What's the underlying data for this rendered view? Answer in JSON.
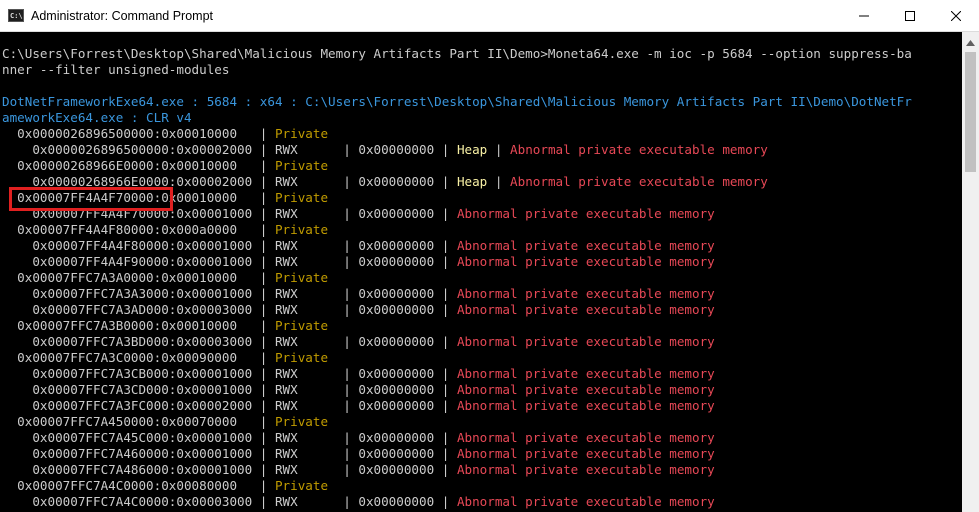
{
  "window": {
    "title": "Administrator: Command Prompt",
    "icon": "cmd-icon",
    "icon_text": "C:\\.",
    "controls": [
      "minimize-icon",
      "maximize-icon",
      "close-icon"
    ]
  },
  "console_lines": [
    {
      "segments": [
        {
          "text": "C:\\Users\\Forrest\\Desktop\\Shared\\Malicious Memory Artifacts Part II\\Demo>Moneta64.exe -m ioc -p 5684 --option suppress-ba",
          "color": "w"
        }
      ]
    },
    {
      "segments": [
        {
          "text": "nner --filter unsigned-modules",
          "color": "w"
        }
      ]
    },
    {
      "segments": [
        {
          "text": "",
          "color": "w"
        }
      ]
    },
    {
      "segments": [
        {
          "text": "DotNetFrameworkExe64.exe : 5684 : x64 : C:\\Users\\Forrest\\Desktop\\Shared\\Malicious Memory Artifacts Part II\\Demo\\DotNetFr",
          "color": "cy"
        }
      ]
    },
    {
      "segments": [
        {
          "text": "ameworkExe64.exe : CLR v4",
          "color": "cy"
        }
      ]
    },
    {
      "segments": [
        {
          "text": "  0x0000026896500000:0x00010000   | ",
          "color": "w"
        },
        {
          "text": "Private",
          "color": "y"
        }
      ]
    },
    {
      "segments": [
        {
          "text": "    0x0000026896500000:0x00002000 | RWX      | 0x00000000 | ",
          "color": "w"
        },
        {
          "text": "Heap",
          "color": "hy"
        },
        {
          "text": " | ",
          "color": "w"
        },
        {
          "text": "Abnormal private executable memory",
          "color": "r"
        }
      ]
    },
    {
      "segments": [
        {
          "text": "  0x00000268966E0000:0x00010000   | ",
          "color": "w"
        },
        {
          "text": "Private",
          "color": "y"
        }
      ]
    },
    {
      "segments": [
        {
          "text": "    0x00000268966E0000:0x00002000 | RWX      | 0x00000000 | ",
          "color": "w"
        },
        {
          "text": "Heap",
          "color": "hy"
        },
        {
          "text": " | ",
          "color": "w"
        },
        {
          "text": "Abnormal private executable memory",
          "color": "r"
        }
      ]
    },
    {
      "segments": [
        {
          "text": "  0x00007FF4A4F70000:0x00010000   | ",
          "color": "w"
        },
        {
          "text": "Private",
          "color": "y"
        }
      ]
    },
    {
      "segments": [
        {
          "text": "    0x00007FF4A4F70000:0x00001000 | RWX      | 0x00000000 | ",
          "color": "w"
        },
        {
          "text": "Abnormal private executable memory",
          "color": "r"
        }
      ]
    },
    {
      "segments": [
        {
          "text": "  0x00007FF4A4F80000:0x000a0000   | ",
          "color": "w"
        },
        {
          "text": "Private",
          "color": "y"
        }
      ]
    },
    {
      "segments": [
        {
          "text": "    0x00007FF4A4F80000:0x00001000 | RWX      | 0x00000000 | ",
          "color": "w"
        },
        {
          "text": "Abnormal private executable memory",
          "color": "r"
        }
      ]
    },
    {
      "segments": [
        {
          "text": "    0x00007FF4A4F90000:0x00001000 | RWX      | 0x00000000 | ",
          "color": "w"
        },
        {
          "text": "Abnormal private executable memory",
          "color": "r"
        }
      ]
    },
    {
      "segments": [
        {
          "text": "  0x00007FFC7A3A0000:0x00010000   | ",
          "color": "w"
        },
        {
          "text": "Private",
          "color": "y"
        }
      ]
    },
    {
      "segments": [
        {
          "text": "    0x00007FFC7A3A3000:0x00001000 | RWX      | 0x00000000 | ",
          "color": "w"
        },
        {
          "text": "Abnormal private executable memory",
          "color": "r"
        }
      ]
    },
    {
      "segments": [
        {
          "text": "    0x00007FFC7A3AD000:0x00003000 | RWX      | 0x00000000 | ",
          "color": "w"
        },
        {
          "text": "Abnormal private executable memory",
          "color": "r"
        }
      ]
    },
    {
      "segments": [
        {
          "text": "  0x00007FFC7A3B0000:0x00010000   | ",
          "color": "w"
        },
        {
          "text": "Private",
          "color": "y"
        }
      ]
    },
    {
      "segments": [
        {
          "text": "    0x00007FFC7A3BD000:0x00003000 | RWX      | 0x00000000 | ",
          "color": "w"
        },
        {
          "text": "Abnormal private executable memory",
          "color": "r"
        }
      ]
    },
    {
      "segments": [
        {
          "text": "  0x00007FFC7A3C0000:0x00090000   | ",
          "color": "w"
        },
        {
          "text": "Private",
          "color": "y"
        }
      ]
    },
    {
      "segments": [
        {
          "text": "    0x00007FFC7A3CB000:0x00001000 | RWX      | 0x00000000 | ",
          "color": "w"
        },
        {
          "text": "Abnormal private executable memory",
          "color": "r"
        }
      ]
    },
    {
      "segments": [
        {
          "text": "    0x00007FFC7A3CD000:0x00001000 | RWX      | 0x00000000 | ",
          "color": "w"
        },
        {
          "text": "Abnormal private executable memory",
          "color": "r"
        }
      ]
    },
    {
      "segments": [
        {
          "text": "    0x00007FFC7A3FC000:0x00002000 | RWX      | 0x00000000 | ",
          "color": "w"
        },
        {
          "text": "Abnormal private executable memory",
          "color": "r"
        }
      ]
    },
    {
      "segments": [
        {
          "text": "  0x00007FFC7A450000:0x00070000   | ",
          "color": "w"
        },
        {
          "text": "Private",
          "color": "y"
        }
      ]
    },
    {
      "segments": [
        {
          "text": "    0x00007FFC7A45C000:0x00001000 | RWX      | 0x00000000 | ",
          "color": "w"
        },
        {
          "text": "Abnormal private executable memory",
          "color": "r"
        }
      ]
    },
    {
      "segments": [
        {
          "text": "    0x00007FFC7A460000:0x00001000 | RWX      | 0x00000000 | ",
          "color": "w"
        },
        {
          "text": "Abnormal private executable memory",
          "color": "r"
        }
      ]
    },
    {
      "segments": [
        {
          "text": "    0x00007FFC7A486000:0x00001000 | RWX      | 0x00000000 | ",
          "color": "w"
        },
        {
          "text": "Abnormal private executable memory",
          "color": "r"
        }
      ]
    },
    {
      "segments": [
        {
          "text": "  0x00007FFC7A4C0000:0x00080000   | ",
          "color": "w"
        },
        {
          "text": "Private",
          "color": "y"
        }
      ]
    },
    {
      "segments": [
        {
          "text": "    0x00007FFC7A4C0000:0x00003000 | RWX      | 0x00000000 | ",
          "color": "w"
        },
        {
          "text": "Abnormal private executable memory",
          "color": "r"
        }
      ]
    }
  ],
  "highlight": {
    "label": "highlighted-address",
    "line_index": 9
  },
  "colors": {
    "w": "#cccccc",
    "cy": "#3a96dd",
    "y": "#c19c00",
    "r": "#e74856",
    "hy": "#f9f1a5",
    "highlight_border": "#e02020",
    "background": "#000000"
  }
}
